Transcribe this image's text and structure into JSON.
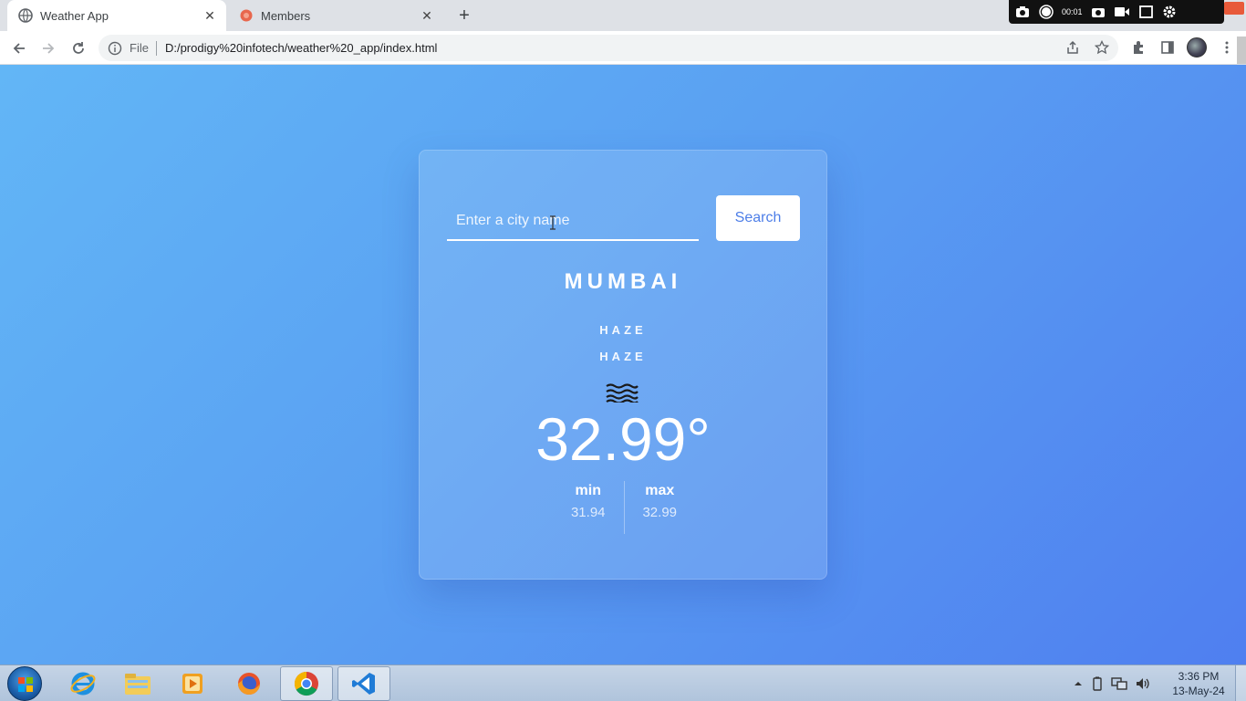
{
  "browser": {
    "tabs": [
      {
        "title": "Weather App",
        "icon": "globe-icon"
      },
      {
        "title": "Members",
        "icon": "members-favicon-icon"
      }
    ],
    "address": {
      "scheme": "File",
      "url": "D:/prodigy%20infotech/weather%20_app/index.html"
    },
    "recorder": {
      "time": "00:01"
    }
  },
  "weather": {
    "search_placeholder": "Enter a city name",
    "search_button": "Search",
    "city": "MUMBAI",
    "description_1": "HAZE",
    "description_2": "HAZE",
    "icon": "haze-icon",
    "temperature": "32.99°",
    "min_label": "min",
    "min_value": "31.94",
    "max_label": "max",
    "max_value": "32.99"
  },
  "taskbar": {
    "apps": [
      "internet-explorer-icon",
      "file-explorer-icon",
      "media-player-icon",
      "firefox-icon",
      "chrome-icon",
      "vscode-icon"
    ],
    "clock_time": "3:36 PM",
    "clock_date": "13-May-24"
  },
  "colors": {
    "accent": "#4d7ee8",
    "gradient_start": "#62b6f6",
    "gradient_end": "#4f7ff0"
  }
}
